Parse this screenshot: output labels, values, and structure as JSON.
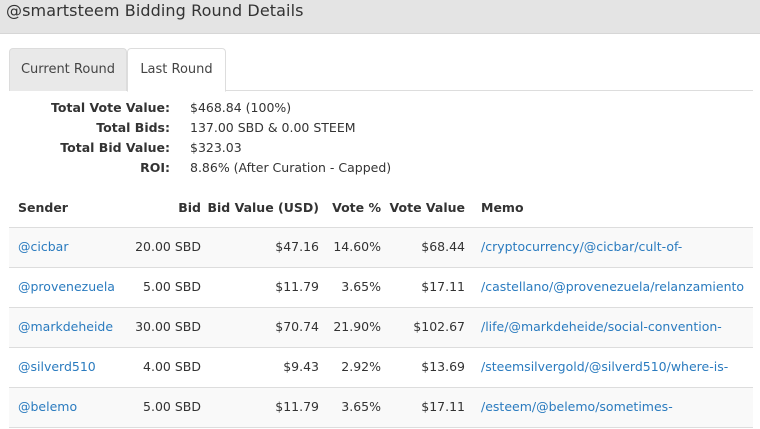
{
  "header": {
    "title": "@smartsteem Bidding Round Details"
  },
  "tabs": [
    {
      "label": "Current Round",
      "active": false
    },
    {
      "label": "Last Round",
      "active": true
    }
  ],
  "summary": {
    "total_vote_value_label": "Total Vote Value:",
    "total_vote_value": "$468.84 (100%)",
    "total_bids_label": "Total Bids:",
    "total_bids": "137.00 SBD & 0.00 STEEM",
    "total_bid_value_label": "Total Bid Value:",
    "total_bid_value": "$323.03",
    "roi_label": "ROI:",
    "roi": "8.86% (After Curation - Capped)"
  },
  "table": {
    "columns": [
      "Sender",
      "Bid",
      "Bid Value (USD)",
      "Vote %",
      "Vote Value",
      "Memo"
    ],
    "rows": [
      {
        "sender": "@cicbar",
        "bid": "20.00 SBD",
        "bid_value": "$47.16",
        "vote_pct": "14.60%",
        "vote_value": "$68.44",
        "memo": "/cryptocurrency/@cicbar/cult-of-"
      },
      {
        "sender": "@provenezuela",
        "bid": "5.00 SBD",
        "bid_value": "$11.79",
        "vote_pct": "3.65%",
        "vote_value": "$17.11",
        "memo": "/castellano/@provenezuela/relanzamiento"
      },
      {
        "sender": "@markdeheide",
        "bid": "30.00 SBD",
        "bid_value": "$70.74",
        "vote_pct": "21.90%",
        "vote_value": "$102.67",
        "memo": "/life/@markdeheide/social-convention-"
      },
      {
        "sender": "@silverd510",
        "bid": "4.00 SBD",
        "bid_value": "$9.43",
        "vote_pct": "2.92%",
        "vote_value": "$13.69",
        "memo": "/steemsilvergold/@silverd510/where-is-"
      },
      {
        "sender": "@belemo",
        "bid": "5.00 SBD",
        "bid_value": "$11.79",
        "vote_pct": "3.65%",
        "vote_value": "$17.11",
        "memo": "/esteem/@belemo/sometimes-"
      }
    ]
  },
  "colors": {
    "link": "#2a7bbf",
    "header_bg": "#e4e4e4",
    "stripe": "#f9f9f9"
  }
}
